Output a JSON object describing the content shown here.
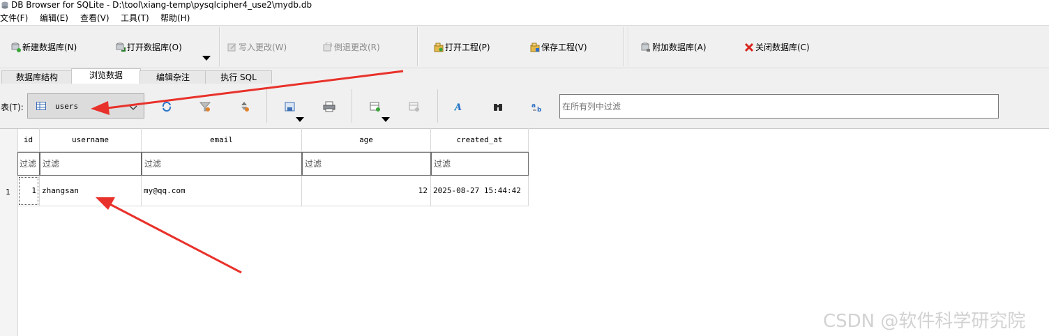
{
  "window": {
    "title": "DB Browser for SQLite - D:\\tool\\xiang-temp\\pysqlcipher4_use2\\mydb.db"
  },
  "menu": [
    "文件(F)",
    "编辑(E)",
    "查看(V)",
    "工具(T)",
    "帮助(H)"
  ],
  "toolbar": {
    "new_db": "新建数据库(N)",
    "open_db": "打开数据库(O)",
    "write_changes": "写入更改(W)",
    "revert_changes": "倒退更改(R)",
    "open_project": "打开工程(P)",
    "save_project": "保存工程(V)",
    "attach_db": "附加数据库(A)",
    "close_db": "关闭数据库(C)"
  },
  "tabs": [
    "数据库结构",
    "浏览数据",
    "编辑杂注",
    "执行 SQL"
  ],
  "browse": {
    "table_label": "表(T):",
    "table_selected": "users",
    "filter_placeholder": "在所有列中过滤"
  },
  "grid": {
    "columns": [
      "id",
      "username",
      "email",
      "age",
      "created_at"
    ],
    "filter_placeholder": "过滤",
    "rows": [
      {
        "num": "1",
        "id": "1",
        "username": "zhangsan",
        "email": "my@qq.com",
        "age": "12",
        "created_at": "2025-08-27 15:44:42"
      }
    ]
  },
  "watermark": "CSDN @软件科学研究院",
  "colors": {
    "arrow": "#e8312a",
    "toolbar_bg": "#f0f0f0",
    "accent": "#1e66c8"
  }
}
